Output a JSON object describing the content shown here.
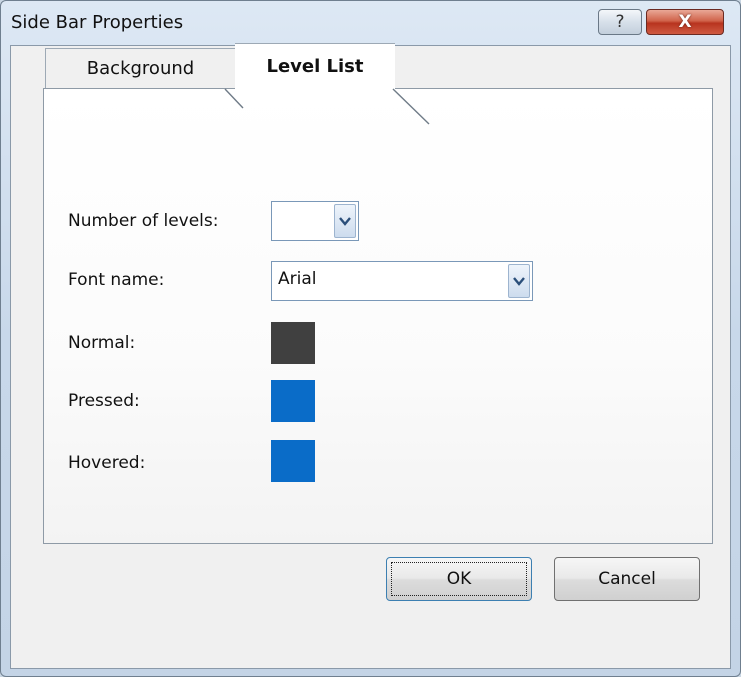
{
  "window": {
    "title": "Side Bar Properties",
    "help_glyph": "?",
    "close_glyph": "X"
  },
  "tabs": [
    {
      "label": "Background",
      "selected": false
    },
    {
      "label": "Level List",
      "selected": true
    }
  ],
  "form": {
    "levels_label": "Number of levels:",
    "levels_value": "",
    "font_label": "Font name:",
    "font_value": "Arial",
    "normal_label": "Normal:",
    "normal_color": "#404040",
    "pressed_label": "Pressed:",
    "pressed_color": "#0a6cc8",
    "hovered_label": "Hovered:",
    "hovered_color": "#0a6cc8"
  },
  "buttons": {
    "ok_label": "OK",
    "cancel_label": "Cancel"
  },
  "icons": {
    "help": "help-icon",
    "close": "close-icon",
    "dropdown": "chevron-down-icon"
  }
}
